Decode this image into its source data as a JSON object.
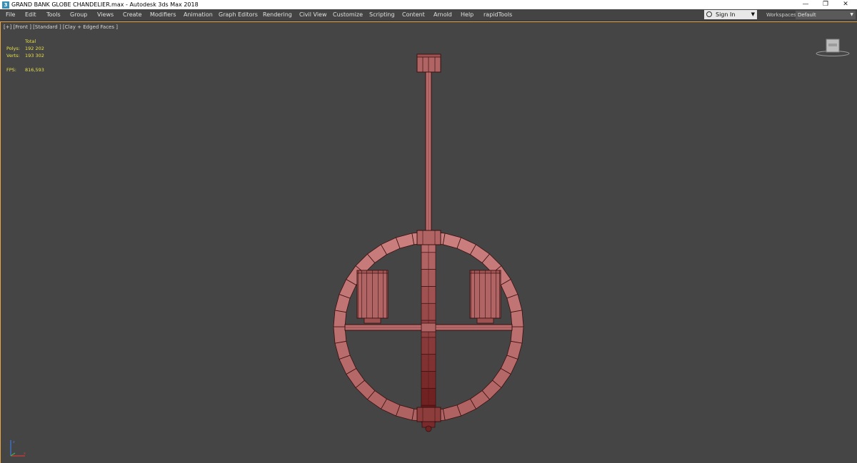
{
  "window": {
    "title": "GRAND BANK GLOBE CHANDELIER.max - Autodesk 3ds Max 2018",
    "app_icon": "3ds-max-icon",
    "controls": [
      "minimize-icon",
      "restore-icon",
      "close-icon"
    ]
  },
  "menu": {
    "items": [
      "File",
      "Edit",
      "Tools",
      "Group",
      "Views",
      "Create",
      "Modifiers",
      "Animation",
      "Graph Editors",
      "Rendering",
      "Civil View",
      "Customize",
      "Scripting",
      "Content",
      "Arnold",
      "Help",
      "rapidTools"
    ]
  },
  "account": {
    "sign_in": "Sign In"
  },
  "workspaces": {
    "label": "Workspaces:",
    "value": "Default"
  },
  "viewport": {
    "label": "[+] [Front ] [Standard ] [Clay + Edged Faces ]",
    "stats": {
      "header": "Total",
      "polys_label": "Polys:",
      "polys_value": "192 202",
      "verts_label": "Verts:",
      "verts_value": "193 302",
      "fps_label": "FPS:",
      "fps_value": "816,593"
    }
  },
  "colors": {
    "model_fill": "#b86b6b",
    "model_dark": "#7a2a2a",
    "model_edge": "#3a1010",
    "active_border": "#e8a84a",
    "stats_text": "#e8e04a"
  }
}
